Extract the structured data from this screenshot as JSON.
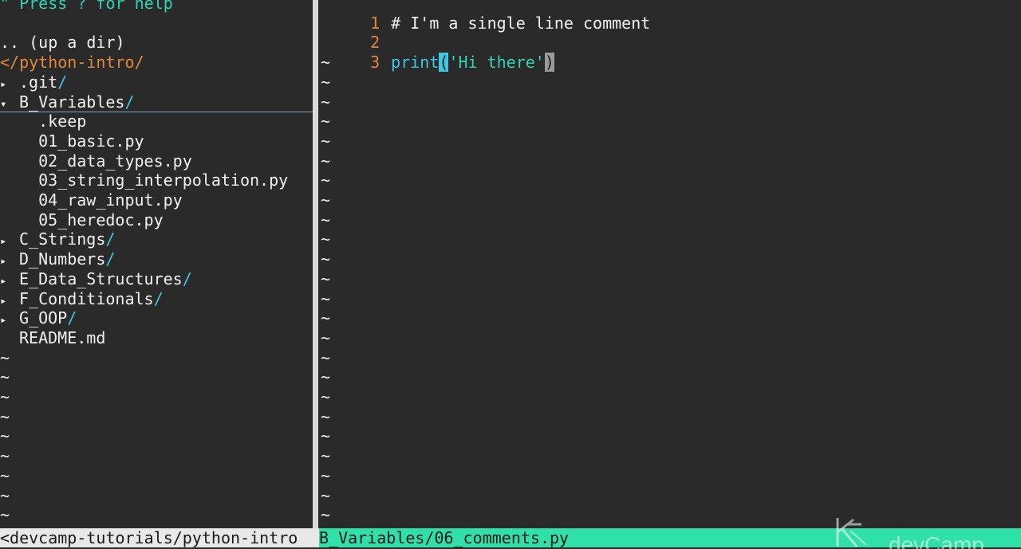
{
  "tree": {
    "help": "\" Press ? for help",
    "updir": ".. (up a dir)",
    "root": "</python-intro/",
    "items": [
      {
        "arrow": "▸",
        "name": ".git",
        "slash": "/"
      },
      {
        "arrow": "▾",
        "name": "B_Variables",
        "slash": "/"
      },
      {
        "arrow": "",
        "name": "  .keep",
        "slash": ""
      },
      {
        "arrow": "",
        "name": "  01_basic.py",
        "slash": ""
      },
      {
        "arrow": "",
        "name": "  02_data_types.py",
        "slash": ""
      },
      {
        "arrow": "",
        "name": "  03_string_interpolation.py",
        "slash": ""
      },
      {
        "arrow": "",
        "name": "  04_raw_input.py",
        "slash": ""
      },
      {
        "arrow": "",
        "name": "  05_heredoc.py",
        "slash": ""
      },
      {
        "arrow": "▸",
        "name": "C_Strings",
        "slash": "/"
      },
      {
        "arrow": "▸",
        "name": "D_Numbers",
        "slash": "/"
      },
      {
        "arrow": "▸",
        "name": "E_Data_Structures",
        "slash": "/"
      },
      {
        "arrow": "▸",
        "name": "F_Conditionals",
        "slash": "/"
      },
      {
        "arrow": "▸",
        "name": "G_OOP",
        "slash": "/"
      },
      {
        "arrow": "",
        "name": "README.md",
        "slash": ""
      }
    ],
    "tilde": "~"
  },
  "editor": {
    "lines": [
      {
        "num": "1",
        "text": "# I'm a single line comment"
      },
      {
        "num": "2",
        "text": ""
      },
      {
        "num": "3",
        "fn": "print",
        "open": "(",
        "str": "'Hi there'",
        "close": ")"
      }
    ],
    "tilde": "~"
  },
  "status": {
    "left": "<devcamp-tutorials/python-intro",
    "right": "B_Variables/06_comments.py"
  },
  "watermark": {
    "text": "devCamp"
  },
  "colors": {
    "background": "#2a2a2a",
    "line_number": "#e0883a",
    "function": "#3ec7e0",
    "string": "#2fd3b5",
    "status_active": "#2fe0a8"
  }
}
